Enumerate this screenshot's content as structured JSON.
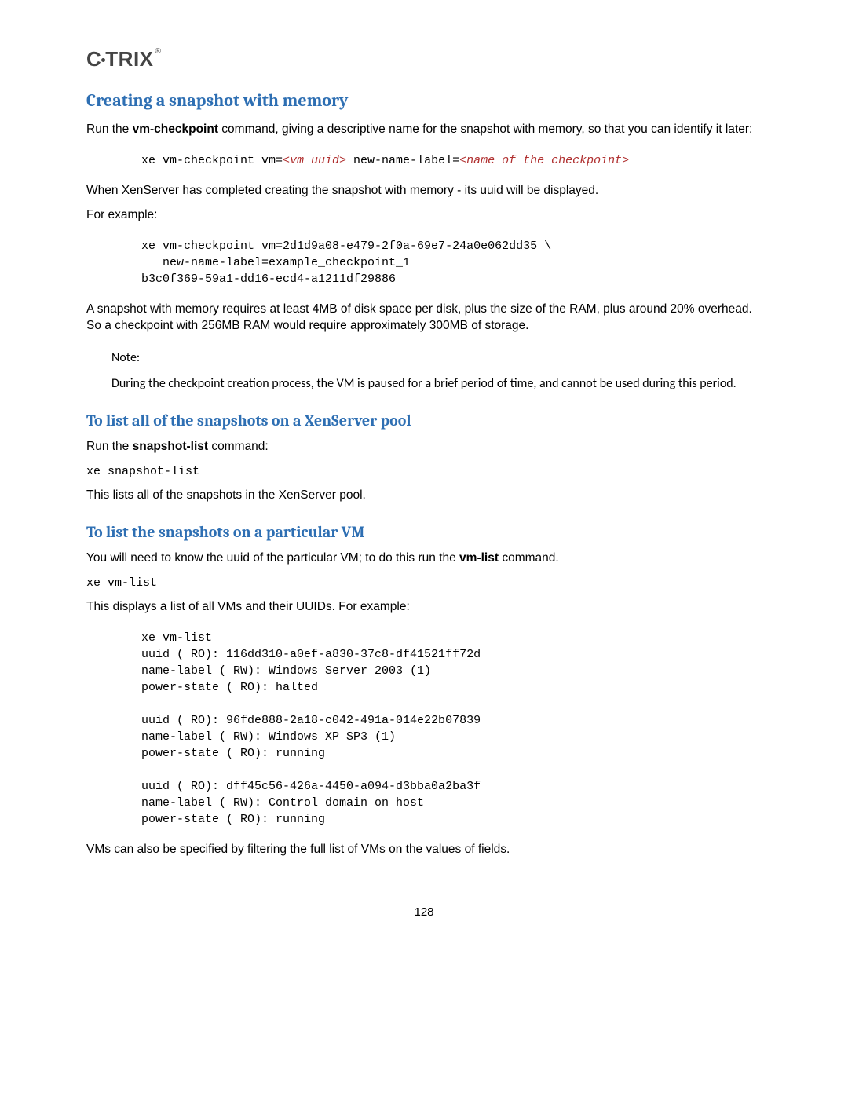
{
  "logo": {
    "text": "CITRIX",
    "reg": "®"
  },
  "h_creating": "Creating a snapshot with memory",
  "p1_a": "Run the ",
  "p1_cmd": "vm-checkpoint",
  "p1_b": " command, giving a descriptive name for the snapshot with memory, so that you can identify it later:",
  "code1_a": "xe vm-checkpoint vm=",
  "code1_b": "<vm uuid>",
  "code1_c": " new-name-label=",
  "code1_d": "<name of the checkpoint>",
  "p2": "When XenServer has completed creating the snapshot with memory - its uuid will be displayed.",
  "p3": "For example:",
  "code2": "xe vm-checkpoint vm=2d1d9a08-e479-2f0a-69e7-24a0e062dd35 \\\n   new-name-label=example_checkpoint_1\nb3c0f369-59a1-dd16-ecd4-a1211df29886",
  "p4": "A snapshot with memory requires at least 4MB of disk space per disk, plus the size of the RAM, plus around 20% overhead. So a checkpoint with 256MB RAM would require approximately 300MB of storage.",
  "note_label": "Note:",
  "note_body": "During the checkpoint creation process, the VM is paused for a brief period of time, and cannot be used during this period.",
  "h_listall": "To list all of the snapshots on a XenServer pool",
  "p5_a": "Run the ",
  "p5_cmd": "snapshot-list",
  "p5_b": " command:",
  "code3": "xe snapshot-list",
  "p6": "This lists all of the snapshots in the XenServer pool.",
  "h_listvm": "To list the snapshots on a particular VM",
  "p7_a": "You will need to know the uuid of the particular VM; to do this run the ",
  "p7_cmd": "vm-list",
  "p7_b": " command.",
  "code4": "xe vm-list",
  "p8": "This displays a list of all VMs and their UUIDs. For example:",
  "code5": "xe vm-list\nuuid ( RO): 116dd310-a0ef-a830-37c8-df41521ff72d\nname-label ( RW): Windows Server 2003 (1)\npower-state ( RO): halted\n\nuuid ( RO): 96fde888-2a18-c042-491a-014e22b07839\nname-label ( RW): Windows XP SP3 (1)\npower-state ( RO): running\n\nuuid ( RO): dff45c56-426a-4450-a094-d3bba0a2ba3f\nname-label ( RW): Control domain on host\npower-state ( RO): running",
  "p9": "VMs can also be specified by filtering the full list of VMs on the values of fields.",
  "page_number": "128"
}
